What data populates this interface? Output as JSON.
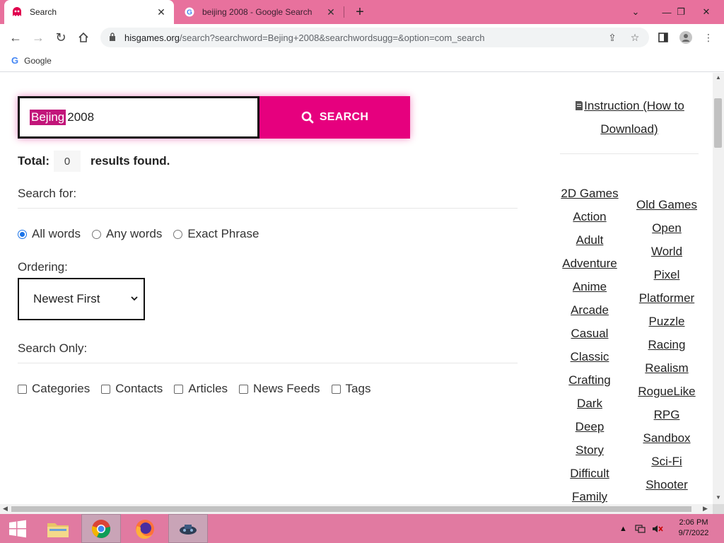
{
  "tabs": [
    {
      "title": "Search",
      "active": true
    },
    {
      "title": "beijing 2008 - Google Search",
      "active": false
    }
  ],
  "toolbar": {
    "url_host": "hisgames.org",
    "url_path": "/search?searchword=Bejing+2008&searchwordsugg=&option=com_search"
  },
  "bookmarks": [
    {
      "label": "Google"
    }
  ],
  "search": {
    "query_selected": "Bejing",
    "query_rest": " 2008",
    "button_label": "SEARCH"
  },
  "results": {
    "total_label": "Total:",
    "count": "0",
    "suffix": "results found."
  },
  "search_for": {
    "label": "Search for:",
    "options": [
      "All words",
      "Any words",
      "Exact Phrase"
    ],
    "selected": "All words"
  },
  "ordering": {
    "label": "Ordering:",
    "selected": "Newest First"
  },
  "search_only": {
    "label": "Search Only:",
    "options": [
      "Categories",
      "Contacts",
      "Articles",
      "News Feeds",
      "Tags"
    ]
  },
  "sidebar": {
    "instruction_line1": "Instruction (How to",
    "instruction_line2": "Download)",
    "categories_left": [
      "2D Games",
      "Action",
      "Adult",
      "Adventure",
      "Anime",
      "Arcade",
      "Casual",
      "Classic",
      "Crafting",
      "Dark",
      "Deep",
      "Story",
      "Difficult",
      "Family"
    ],
    "categories_right": [
      "Old Games",
      "Open",
      "World",
      "Pixel",
      "Platformer",
      "Puzzle",
      "Racing",
      "Realism",
      "RogueLike",
      "RPG",
      "Sandbox",
      "Sci-Fi",
      "Shooter"
    ]
  },
  "taskbar": {
    "time": "2:06 PM",
    "date": "9/7/2022"
  },
  "colors": {
    "accent": "#e6007e",
    "tabstrip": "#e8719d",
    "taskbar": "#e17aa1"
  }
}
